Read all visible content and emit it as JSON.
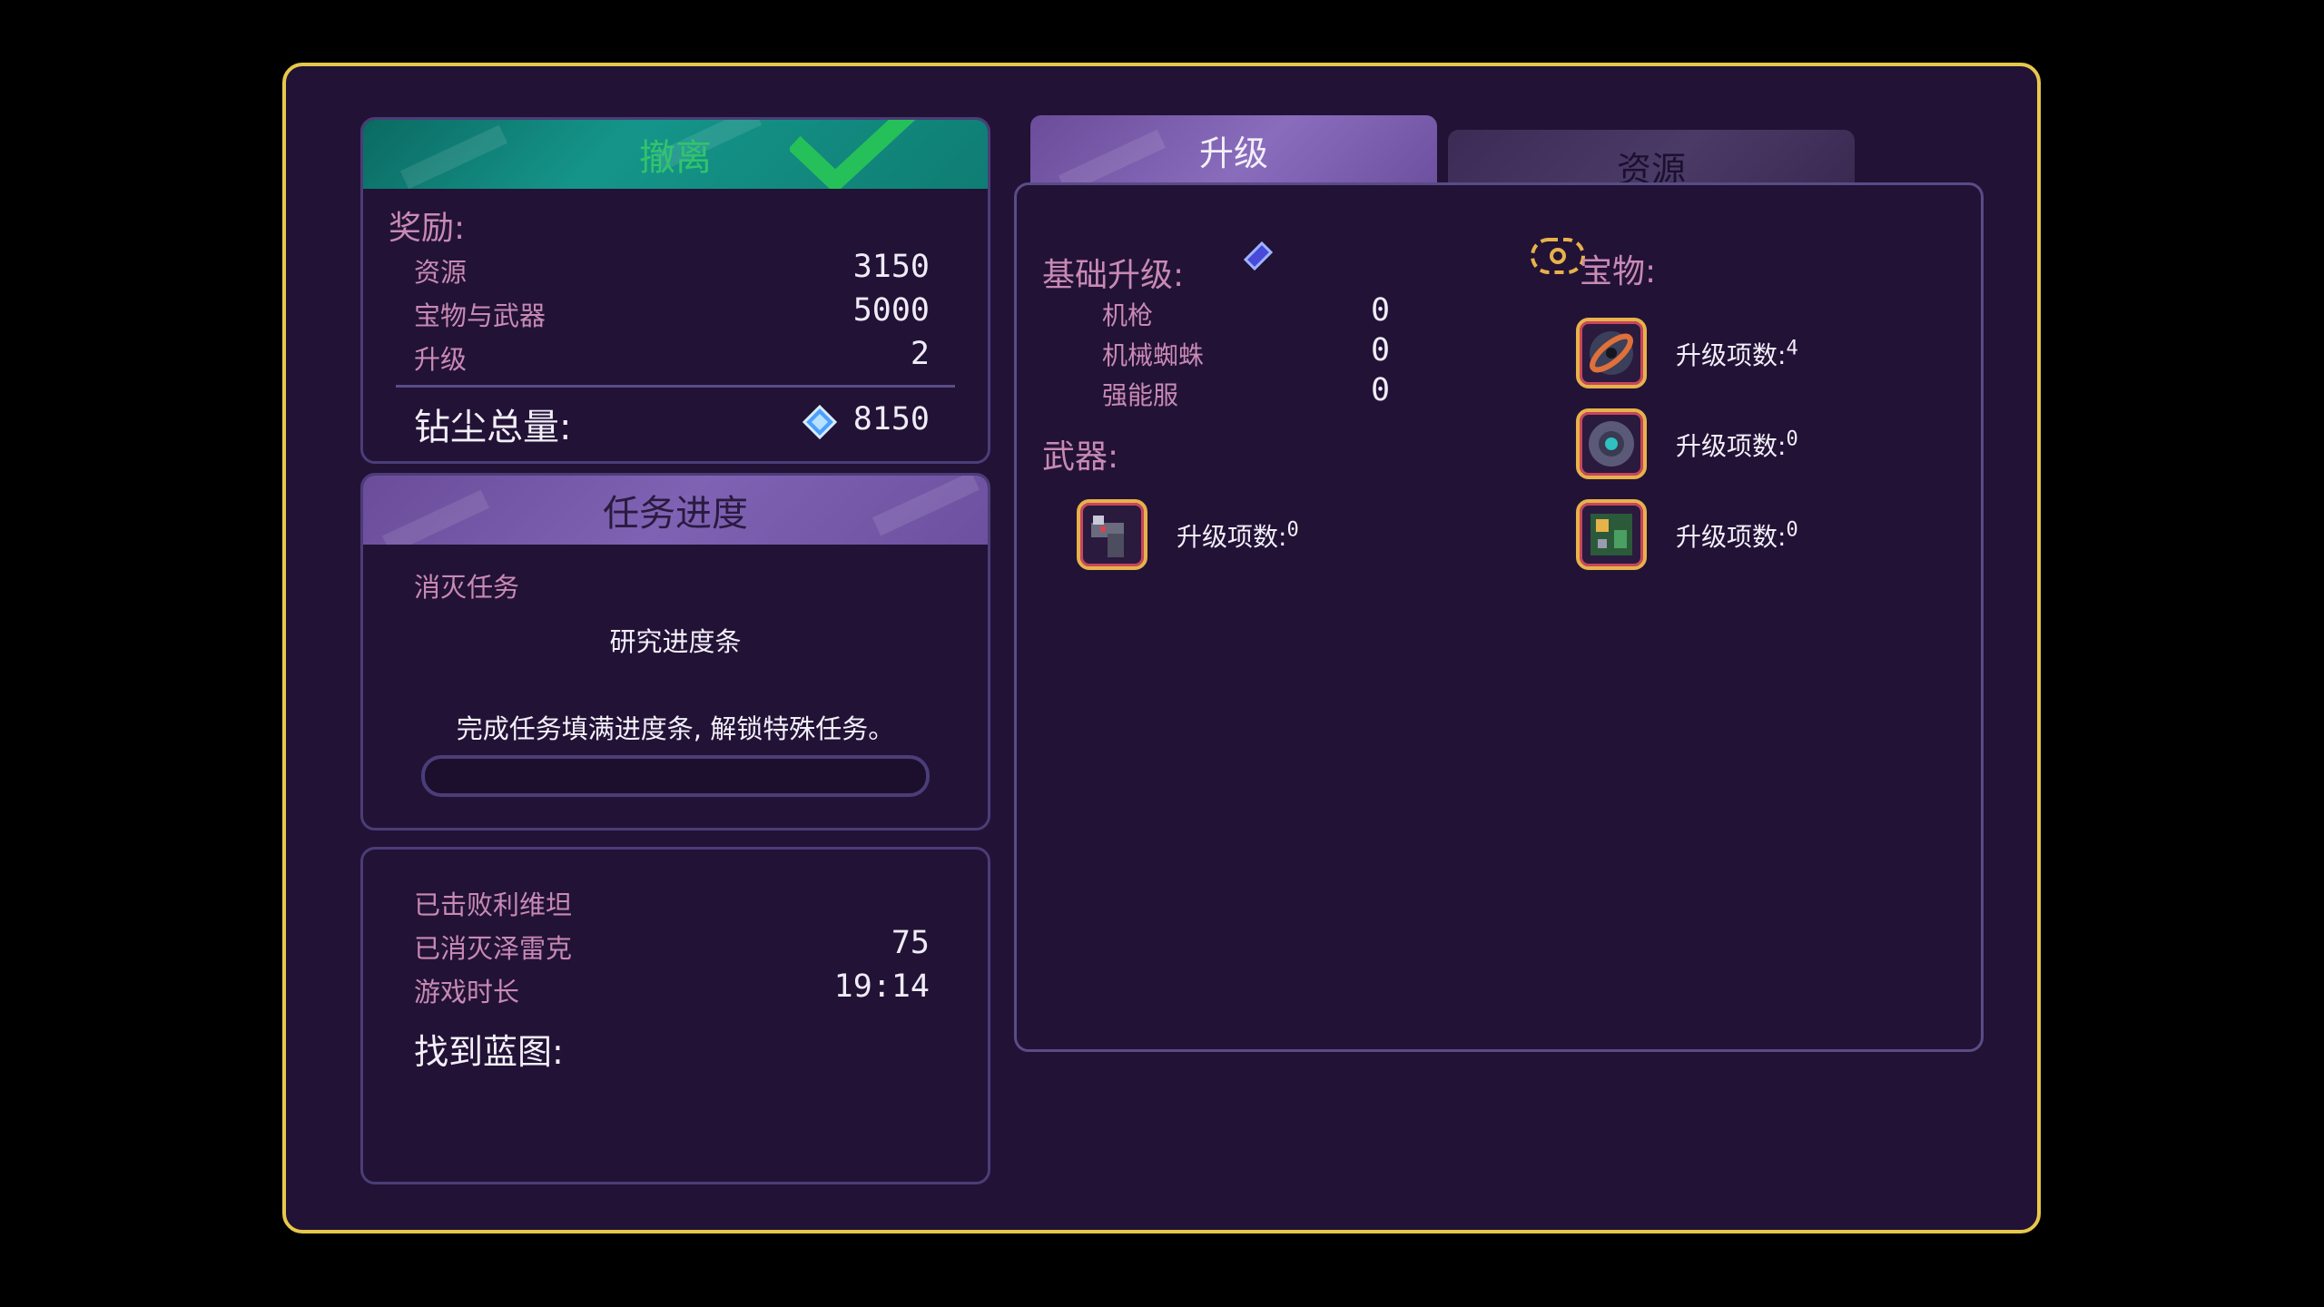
{
  "extraction": {
    "header": "撤离"
  },
  "rewards": {
    "title": "奖励:",
    "rows": [
      {
        "label": "资源",
        "value": "3150"
      },
      {
        "label": "宝物与武器",
        "value": "5000"
      },
      {
        "label": "升级",
        "value": "2"
      }
    ],
    "total_label": "钻尘总量:",
    "total_value": "8150"
  },
  "mission": {
    "header": "任务进度",
    "type": "消灭任务",
    "bar_title": "研究进度条",
    "description": "完成任务填满进度条, 解锁特殊任务。",
    "progress": 0
  },
  "stats": {
    "rows": [
      {
        "label": "已击败利维坦",
        "value": ""
      },
      {
        "label": "已消灭泽雷克",
        "value": "75"
      },
      {
        "label": "游戏时长",
        "value": "19:14"
      }
    ],
    "blueprints_label": "找到蓝图:"
  },
  "tabs": [
    {
      "label": "升级",
      "active": true
    },
    {
      "label": "资源",
      "active": false
    }
  ],
  "upgrades": {
    "base_title": "基础升级:",
    "base_items": [
      {
        "label": "机枪",
        "value": "0"
      },
      {
        "label": "机械蜘蛛",
        "value": "0"
      },
      {
        "label": "强能服",
        "value": "0"
      }
    ],
    "weapons_title": "武器:",
    "weapons": [
      {
        "icon": "gun-icon",
        "label": "升级项数:",
        "count": "0"
      }
    ],
    "relics_title": "宝物:",
    "relics": [
      {
        "icon": "orb-icon",
        "label": "升级项数:",
        "count": "4"
      },
      {
        "icon": "core-icon",
        "label": "升级项数:",
        "count": "0"
      },
      {
        "icon": "circuit-icon",
        "label": "升级项数:",
        "count": "0"
      }
    ]
  },
  "colors": {
    "frame": "#e8c84a",
    "panel_bg": "#211236",
    "teal": "#15958a",
    "purple": "#7f62b3",
    "label": "#c88ab4"
  }
}
